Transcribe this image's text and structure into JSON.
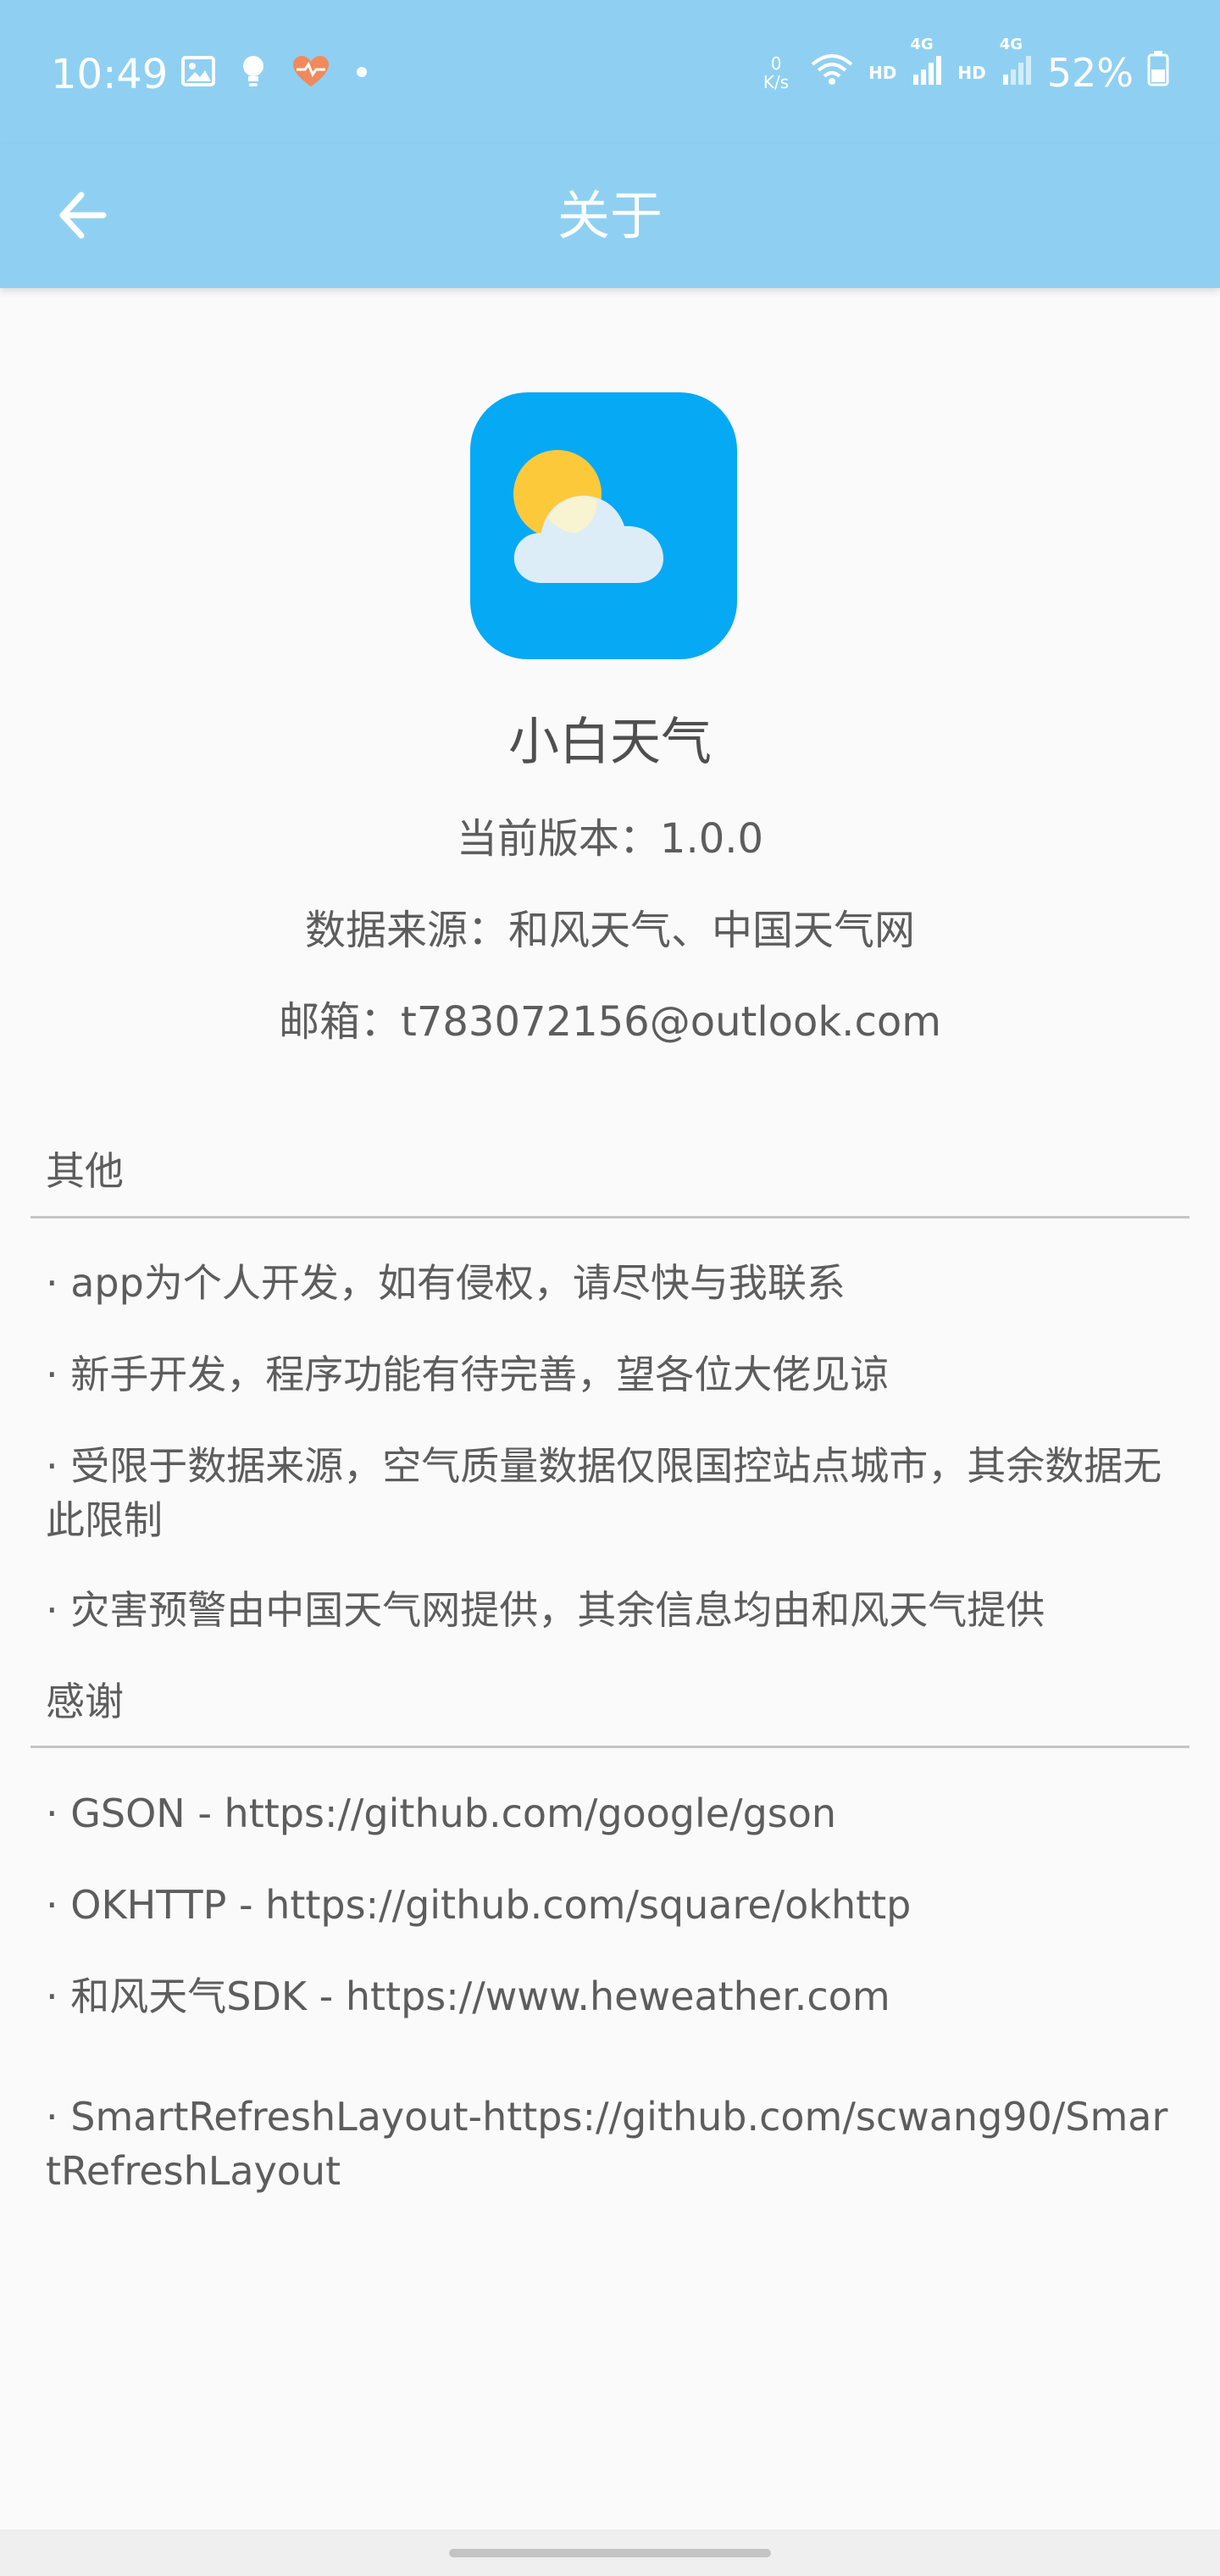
{
  "status_bar": {
    "time": "10:49",
    "net_speed_value": "0",
    "net_speed_unit": "K/s",
    "hd_label_1": "HD",
    "hd_label_2": "HD",
    "network_1": "4G",
    "network_2": "4G",
    "battery": "52%",
    "icons": [
      "image-icon",
      "bulb-icon",
      "heart-icon",
      "dot-icon",
      "wifi-icon",
      "signal-icon",
      "battery-icon"
    ]
  },
  "app_bar": {
    "title": "关于"
  },
  "app_info": {
    "name": "小白天气",
    "version": "当前版本：1.0.0",
    "data_source": "数据来源：和风天气、中国天气网",
    "email": "邮箱：t783072156@outlook.com"
  },
  "sections": {
    "other": {
      "title": "其他",
      "items": [
        "·  app为个人开发，如有侵权，请尽快与我联系",
        "· 新手开发，程序功能有待完善，望各位大佬见谅",
        "· 受限于数据来源，空气质量数据仅限国控站点城市，其余数据无此限制",
        "· 灾害预警由中国天气网提供，其余信息均由和风天气提供"
      ]
    },
    "thanks": {
      "title": "感谢",
      "items": [
        "· GSON - https://github.com/google/gson",
        "· OKHTTP - https://github.com/square/okhttp",
        "· 和风天气SDK - https://www.heweather.com",
        "· SmartRefreshLayout-https://github.com/scwang90/SmartRefreshLayout"
      ]
    }
  },
  "colors": {
    "app_bar": "#8fd0f2",
    "icon_background": "#06a9f4",
    "sun": "#fcc93a",
    "cloud": "#dcedf7",
    "text": "#5d5d5d",
    "divider": "#c6c6c6"
  }
}
